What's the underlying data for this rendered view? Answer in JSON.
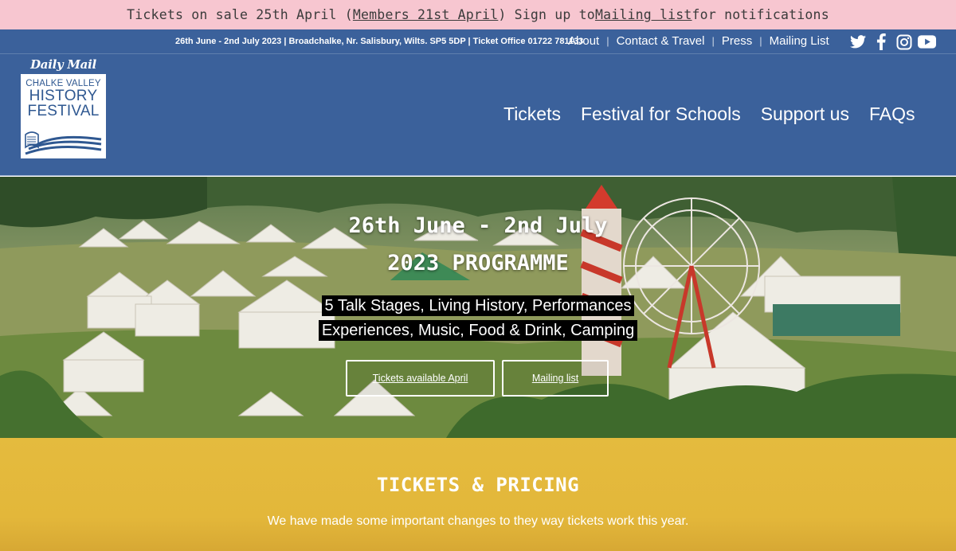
{
  "announcement": {
    "part1": "Tickets on sale 25th April (",
    "members_link": "Members 21st April",
    "part2": ") Sign up to ",
    "mailing_link": "Mailing list",
    "part3": " for notifications"
  },
  "header": {
    "info": "26th June - 2nd July 2023 | Broadchalke, Nr. Salisbury, Wilts. SP5 5DP | Ticket Office 01722 781133",
    "top_links": [
      "About",
      "Contact & Travel",
      "Press",
      "Mailing List"
    ],
    "social_icons": [
      "twitter-icon",
      "facebook-icon",
      "instagram-icon",
      "youtube-icon"
    ],
    "sponsor": "Daily Mail",
    "logo": {
      "line1": "CHALKE VALLEY",
      "line2": "HISTORY",
      "line3": "FESTIVAL"
    },
    "main_nav": [
      "Tickets",
      "Festival for Schools",
      "Support us",
      "FAQs"
    ]
  },
  "hero": {
    "title_line1": "26th June - 2nd July",
    "title_line2": "2023 PROGRAMME",
    "subtitle_line1": "5 Talk Stages, Living History, Performances",
    "subtitle_line2": "Experiences, Music, Food & Drink, Camping",
    "button_tickets": "Tickets available April",
    "button_mailing": "Mailing list"
  },
  "tickets_section": {
    "heading": "TICKETS & PRICING",
    "text": "We have made some important changes to they way tickets work this year."
  },
  "colors": {
    "announcement_bg": "#f7c6d0",
    "header_bg": "#3b619b",
    "tickets_bg": "#e4bb3e"
  }
}
